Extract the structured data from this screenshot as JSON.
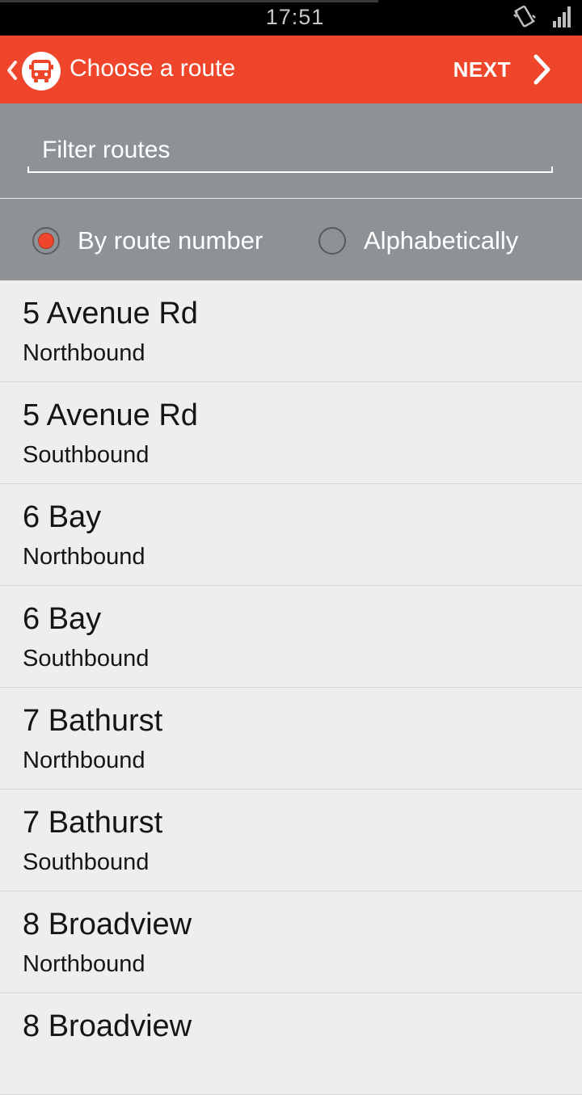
{
  "status_bar": {
    "time": "17:51",
    "icons": [
      "vibrate-icon",
      "signal-icon"
    ]
  },
  "app_bar": {
    "title": "Choose a route",
    "next_label": "NEXT",
    "accent_color": "#ee452b",
    "logo_icon": "bus-icon"
  },
  "filter": {
    "placeholder": "Filter routes",
    "value": ""
  },
  "sort": {
    "options": [
      {
        "label": "By route number",
        "selected": true
      },
      {
        "label": "Alphabetically",
        "selected": false
      }
    ]
  },
  "routes": [
    {
      "name": "5 Avenue Rd",
      "direction": "Northbound"
    },
    {
      "name": "5 Avenue Rd",
      "direction": "Southbound"
    },
    {
      "name": "6 Bay",
      "direction": "Northbound"
    },
    {
      "name": "6 Bay",
      "direction": "Southbound"
    },
    {
      "name": "7 Bathurst",
      "direction": "Northbound"
    },
    {
      "name": "7 Bathurst",
      "direction": "Southbound"
    },
    {
      "name": "8 Broadview",
      "direction": "Northbound"
    },
    {
      "name": "8 Broadview",
      "direction": ""
    }
  ]
}
